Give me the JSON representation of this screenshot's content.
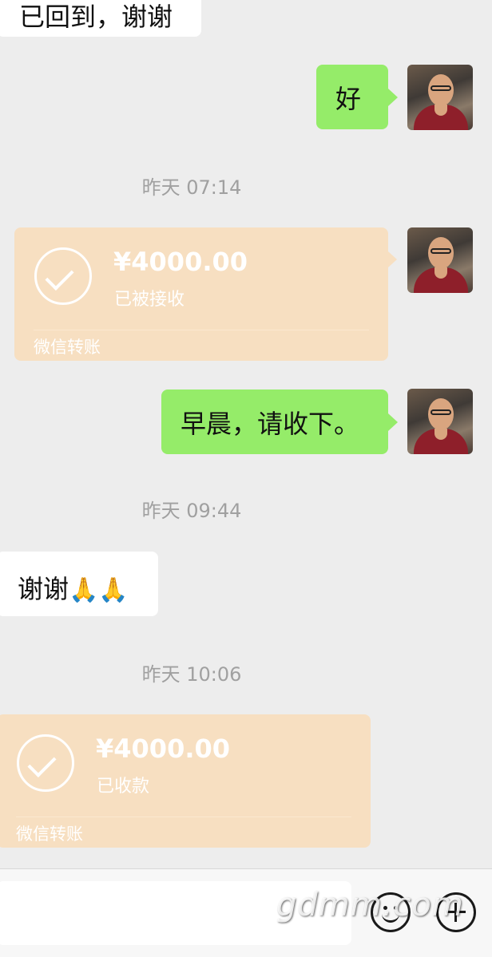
{
  "messages": {
    "m1_text": "已回到，谢谢",
    "m2_text": "好",
    "t1": "昨天 07:14",
    "transfer1": {
      "amount": "¥4000.00",
      "status": "已被接收",
      "label": "微信转账"
    },
    "m3_text": "早晨，请收下。",
    "t2": "昨天 09:44",
    "m4_text": "谢谢",
    "m4_emoji": "🙏🙏",
    "t3": "昨天 10:06",
    "transfer2": {
      "amount": "¥4000.00",
      "status": "已收款",
      "label": "微信转账"
    }
  },
  "input_bar": {
    "placeholder": "",
    "emoji_icon": "smiley-icon",
    "more_icon": "plus-icon"
  },
  "watermark": "gdmm.com",
  "colors": {
    "background": "#ededed",
    "sent_bubble": "#95ec69",
    "received_bubble": "#ffffff",
    "transfer_card": "#f7dfc1",
    "timestamp": "#a0a0a0"
  }
}
